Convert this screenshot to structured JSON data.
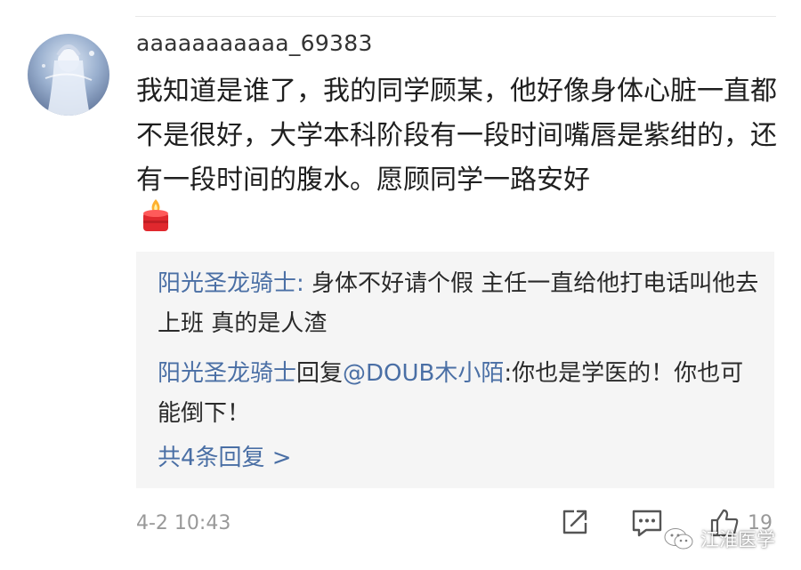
{
  "comment": {
    "username": "aaaaaaaaaaa_69383",
    "text": "我知道是谁了，我的同学顾某，他好像身体心脏一直都不是很好，大学本科阶段有一段时间嘴唇是紫绀的，还有一段时间的腹水。愿顾同学一路安好",
    "emoji_icon": "candle-icon",
    "timestamp": "4-2 10:43",
    "like_count": "19"
  },
  "replies": [
    {
      "author": "阳光圣龙骑士",
      "separator": ": ",
      "text": "身体不好请个假 主任一直给他打电话叫他去上班 真的是人渣"
    },
    {
      "author": "阳光圣龙骑士",
      "reply_word": "回复",
      "mention": "@DOUB木小陌",
      "separator": ":",
      "text": "你也是学医的！你也可能倒下！"
    }
  ],
  "more_replies_label": "共4条回复 >",
  "watermark": {
    "text": "江淮医学"
  },
  "colors": {
    "link": "#4a6fa5",
    "reply_bg": "#f5f5f5",
    "meta_text": "#999999"
  }
}
